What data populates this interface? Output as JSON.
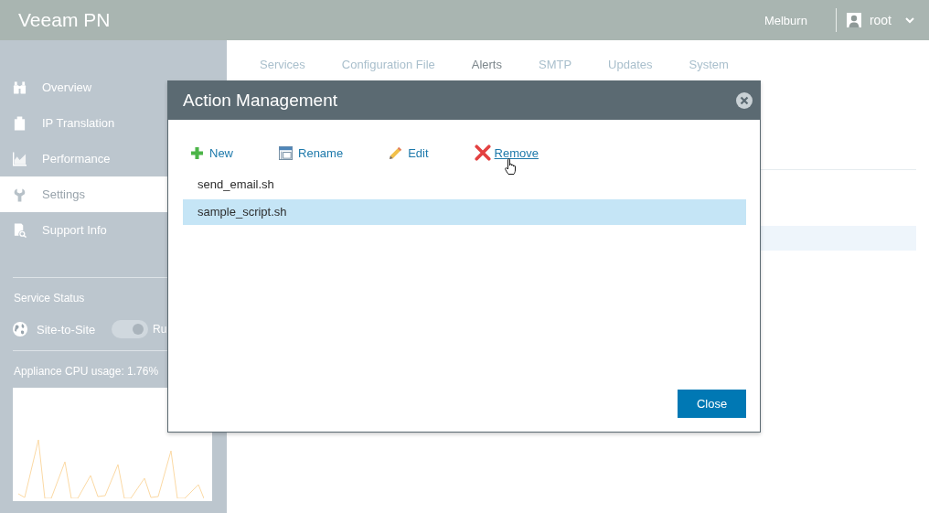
{
  "header": {
    "title": "Veeam PN",
    "location": "Melburn",
    "user": "root"
  },
  "sidebar": {
    "items": [
      {
        "label": "Overview",
        "selected": false
      },
      {
        "label": "IP Translation",
        "selected": false
      },
      {
        "label": "Performance",
        "selected": false
      },
      {
        "label": "Settings",
        "selected": true
      },
      {
        "label": "Support Info",
        "selected": false
      }
    ]
  },
  "service_status": {
    "heading": "Service Status",
    "services": [
      {
        "name": "Site-to-Site",
        "on": true,
        "status": "Ru"
      }
    ]
  },
  "cpu": {
    "label": "Appliance CPU usage: 1.76%"
  },
  "tabs": [
    {
      "label": "Services",
      "selected": false
    },
    {
      "label": "Configuration File",
      "selected": false
    },
    {
      "label": "Alerts",
      "selected": true
    },
    {
      "label": "SMTP",
      "selected": false
    },
    {
      "label": "Updates",
      "selected": false
    },
    {
      "label": "System",
      "selected": false
    }
  ],
  "dialog": {
    "title": "Action Management",
    "toolbar": [
      {
        "label": "New",
        "hovered": false
      },
      {
        "label": "Rename",
        "hovered": false
      },
      {
        "label": "Edit",
        "hovered": false
      },
      {
        "label": "Remove",
        "hovered": true
      }
    ],
    "items": [
      {
        "name": "send_email.sh",
        "selected": false
      },
      {
        "name": "sample_script.sh",
        "selected": true
      }
    ],
    "button": "Close"
  }
}
